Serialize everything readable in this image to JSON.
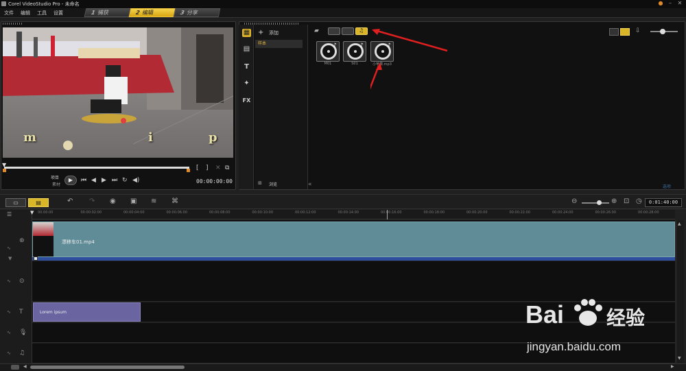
{
  "window": {
    "title": "Corel VideoStudio Pro - 未命名"
  },
  "menu": [
    "文件",
    "编辑",
    "工具",
    "设置"
  ],
  "steps": [
    {
      "num": "1",
      "label": "捕获"
    },
    {
      "num": "2",
      "label": "编辑"
    },
    {
      "num": "3",
      "label": "分享"
    }
  ],
  "preview": {
    "subtitle_letters": [
      "m",
      "i",
      "p"
    ],
    "mode_project": "项目",
    "mode_clip": "素材",
    "bracket_in": "[",
    "bracket_out": "]",
    "timecode": "00:00:00:00"
  },
  "library": {
    "add_label": "添加",
    "folder": "样本",
    "browse_label": "浏览",
    "options_label": "选项",
    "items": [
      {
        "caption": "M01"
      },
      {
        "caption": "S01"
      },
      {
        "caption": "小苹果.mp3"
      }
    ]
  },
  "toolbar": {
    "zoom_timecode": "0:01:40:00"
  },
  "timeline": {
    "ruler": [
      "00:00:00",
      "00:00:02:00",
      "00:00:04:00",
      "00:00:06:00",
      "00:00:08:00",
      "00:00:10:00",
      "00:00:12:00",
      "00:00:14:00",
      "00:00:16:00",
      "00:00:18:00",
      "00:00:20:00",
      "00:00:22:00",
      "00:00:24:00",
      "00:00:26:00",
      "00:00:28:00"
    ],
    "video_clip": "漂移车01.mp4",
    "title_clip": "Lorem ipsum"
  },
  "watermark": {
    "brand": "Bai",
    "brand2": "经验",
    "url": "jingyan.baidu.com"
  },
  "colors": {
    "accent": "#d9b528",
    "video_clip": "#5f8c97",
    "title_clip": "#6a64a0",
    "blue_bar": "#2d4f9e",
    "arrow": "#e02020"
  }
}
